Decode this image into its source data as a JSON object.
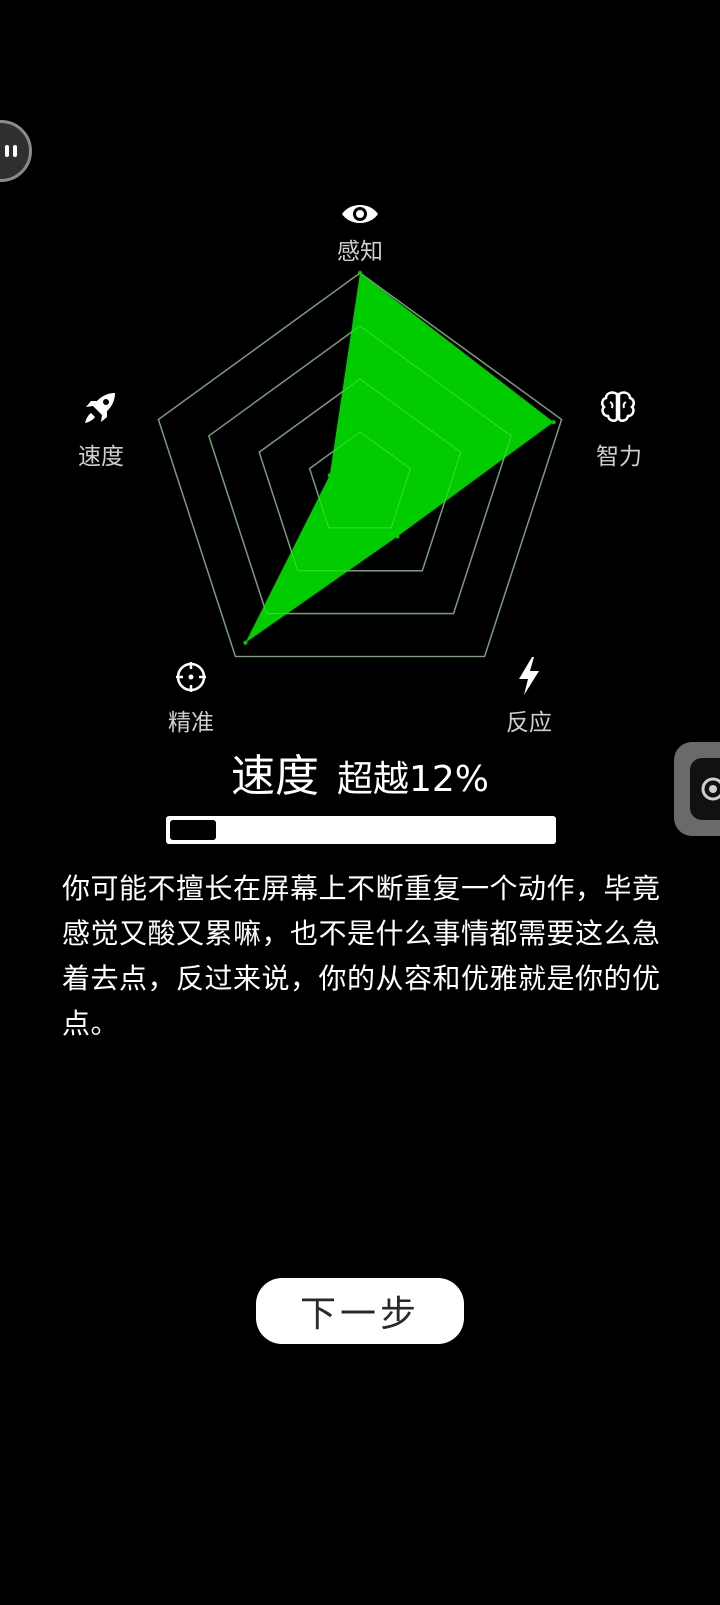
{
  "radar": {
    "axes": [
      {
        "label": "感知",
        "icon": "eye-icon",
        "value": 1.0
      },
      {
        "label": "智力",
        "icon": "brain-icon",
        "value": 0.96
      },
      {
        "label": "反应",
        "icon": "lightning-icon",
        "value": 0.3
      },
      {
        "label": "精准",
        "icon": "crosshair-icon",
        "value": 0.92
      },
      {
        "label": "速度",
        "icon": "rocket-icon",
        "value": 0.15
      }
    ],
    "fill_color": "#00cc00",
    "grid_color": "#6e6e6e",
    "rings": 4
  },
  "result": {
    "title": "速度",
    "subtitle": "超越12%",
    "percent": 12
  },
  "description": "你可能不擅长在屏幕上不断重复一个动作，毕竟感觉又酸又累嘛，也不是什么事情都需要这么急着去点，反过来说，你的从容和优雅就是你的优点。",
  "buttons": {
    "next_label": "下一步"
  }
}
